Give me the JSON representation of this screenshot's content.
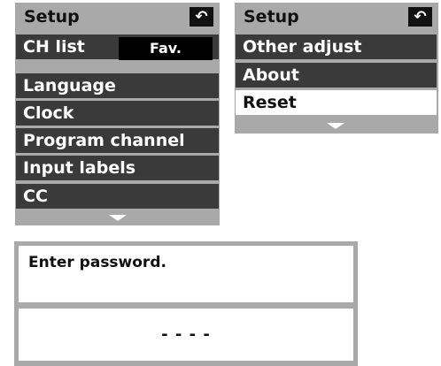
{
  "left_menu": {
    "title": "Setup",
    "back_icon": "back-arrow-icon",
    "ch_list": {
      "label": "CH list",
      "value": "Fav."
    },
    "items": [
      {
        "label": "Language"
      },
      {
        "label": "Clock"
      },
      {
        "label": "Program channel"
      },
      {
        "label": "Input labels"
      },
      {
        "label": "CC"
      }
    ]
  },
  "right_menu": {
    "title": "Setup",
    "back_icon": "back-arrow-icon",
    "items": [
      {
        "label": "Other adjust",
        "selected": false
      },
      {
        "label": "About",
        "selected": false
      },
      {
        "label": "Reset",
        "selected": true
      }
    ]
  },
  "password_dialog": {
    "prompt": "Enter password.",
    "value": "- - - -"
  },
  "colors": {
    "panel_bg": "#a9a9a9",
    "row_bg": "#3a3a3a",
    "selected_bg": "#ffffff",
    "text_light": "#ffffff",
    "text_dark": "#111111"
  }
}
